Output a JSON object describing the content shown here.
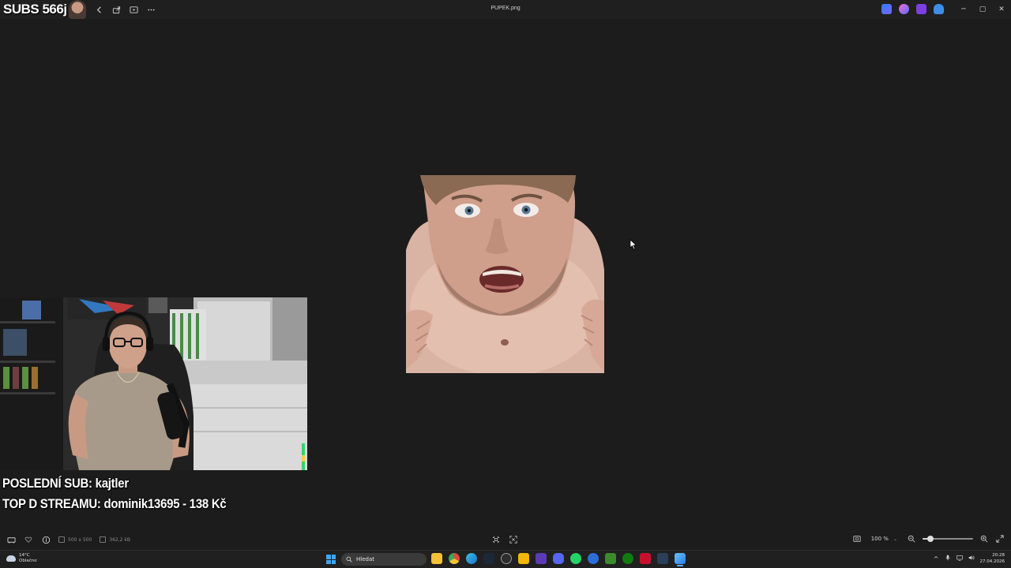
{
  "titlebar": {
    "file_name": "PUPEK.png",
    "subs_overlay": "SUBS 566j",
    "tools": [
      "back-icon",
      "share-icon",
      "slideshow-icon",
      "more-icon"
    ],
    "window_controls": [
      "─",
      "▢",
      "✕"
    ]
  },
  "overlay": {
    "last_sub": "POSLEDNÍ SUB: kajtler",
    "top_donation": "TOP D STREAMU: dominik13695 - 138 Kč"
  },
  "statusbar": {
    "dimensions": "500 x 500",
    "file_size": "362,2 kB",
    "zoom_label": "100 %",
    "zoom_level_fraction": 0.15
  },
  "taskbar": {
    "weather_temp": "14°C",
    "weather_desc": "Oblačno",
    "search_placeholder": "Hledat",
    "time": "20:28",
    "date": "27.04.2026"
  },
  "colors": {
    "accent": "#5fb2ff",
    "background": "#1c1c1c",
    "start_blue": "#3ea6f5"
  }
}
